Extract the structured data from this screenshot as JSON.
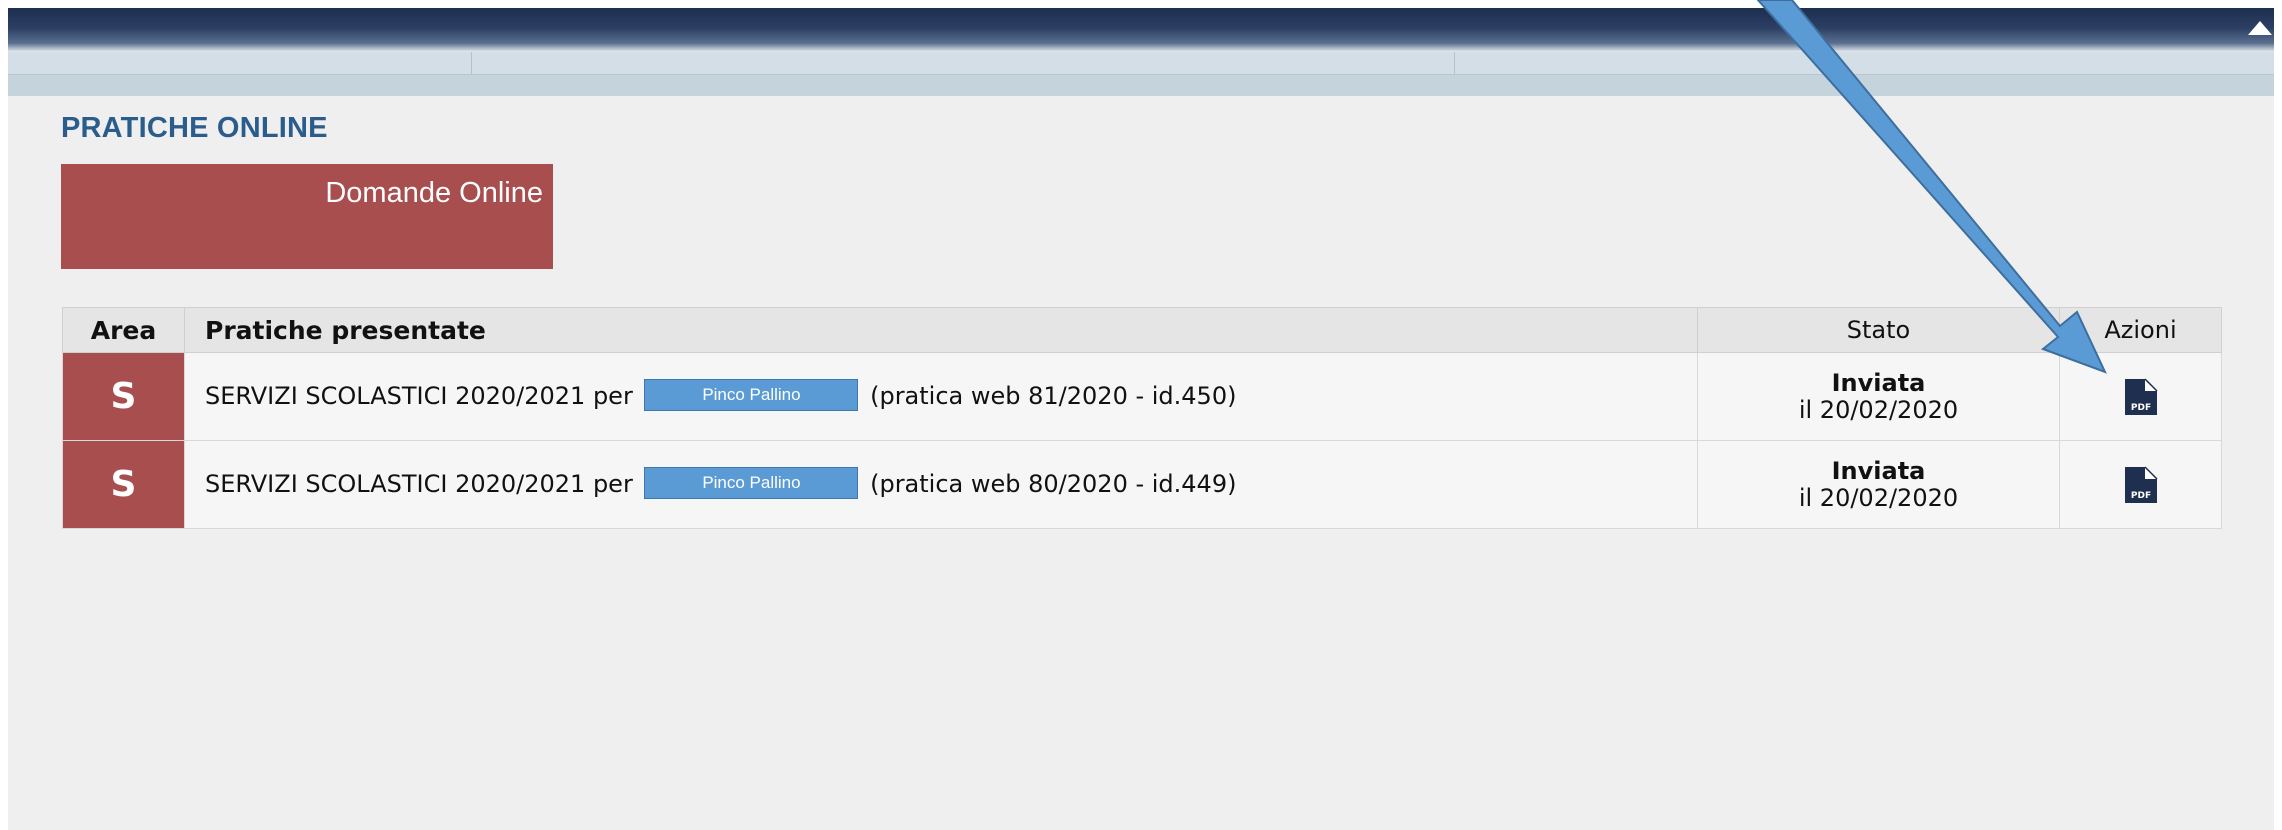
{
  "section": {
    "title": "PRATICHE ONLINE"
  },
  "tile": {
    "label": "Domande Online",
    "color": "#a94e4f"
  },
  "table": {
    "headers": {
      "area": "Area",
      "pratiche": "Pratiche presentate",
      "stato": "Stato",
      "azioni": "Azioni"
    },
    "rows": [
      {
        "area": "S",
        "desc_prefix": "SERVIZI SCOLASTICI 2020/2021 per",
        "name": "Pinco Pallino",
        "desc_suffix": "(pratica web 81/2020 - id.450)",
        "status": "Inviata",
        "status_date": "il 20/02/2020",
        "action_icon": "pdf-file-icon"
      },
      {
        "area": "S",
        "desc_prefix": "SERVIZI SCOLASTICI 2020/2021 per",
        "name": "Pinco Pallino",
        "desc_suffix": "(pratica web 80/2020 - id.449)",
        "status": "Inviata",
        "status_date": "il 20/02/2020",
        "action_icon": "pdf-file-icon"
      }
    ]
  },
  "colors": {
    "header_bar": "#1e2f4f",
    "title": "#2b5d8c",
    "area_badge": "#a94e4f",
    "annotation_arrow": "#5b9bd5",
    "name_highlight": "#5b9bd5"
  },
  "icons": {
    "scroll": "scroll-up-icon",
    "pdf": "pdf-file-icon",
    "annotation": "annotation-arrow-icon"
  }
}
